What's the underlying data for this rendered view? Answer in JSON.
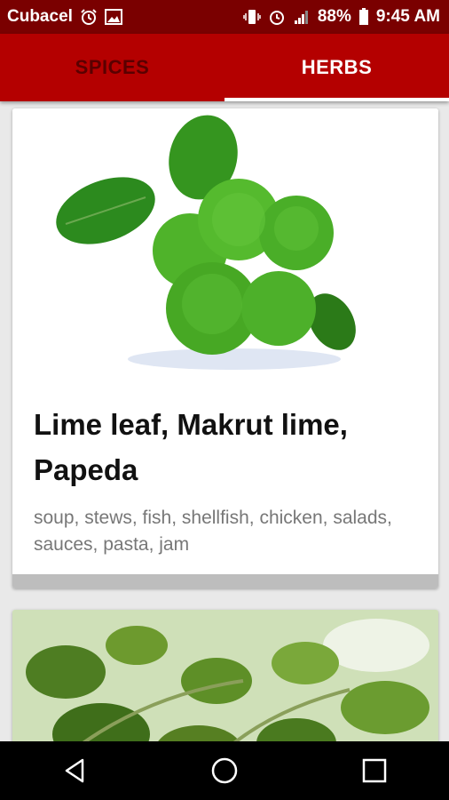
{
  "status_bar": {
    "carrier": "Cubacel",
    "battery": "88%",
    "time": "9:45 AM",
    "icons_left": [
      "alarm-clock-icon",
      "image-icon"
    ],
    "icons_right": [
      "vibrate-icon",
      "alarm-icon",
      "signal-icon",
      "battery-icon"
    ],
    "bg_color": "#7a0000"
  },
  "tabs": [
    {
      "label": "SPICES",
      "active": false
    },
    {
      "label": "HERBS",
      "active": true
    }
  ],
  "tab_bar_color": "#b40000",
  "cards": [
    {
      "image": "makrut-lime-fruit-and-leaves",
      "title": "Lime leaf, Makrut lime, Papeda",
      "description": "soup, stews, fish, shellfish, chicken, salads, sauces, pasta, jam"
    },
    {
      "image": "oregano-leaves"
    }
  ],
  "nav_bar": {
    "buttons": [
      "back-icon",
      "home-icon",
      "recents-icon"
    ]
  }
}
